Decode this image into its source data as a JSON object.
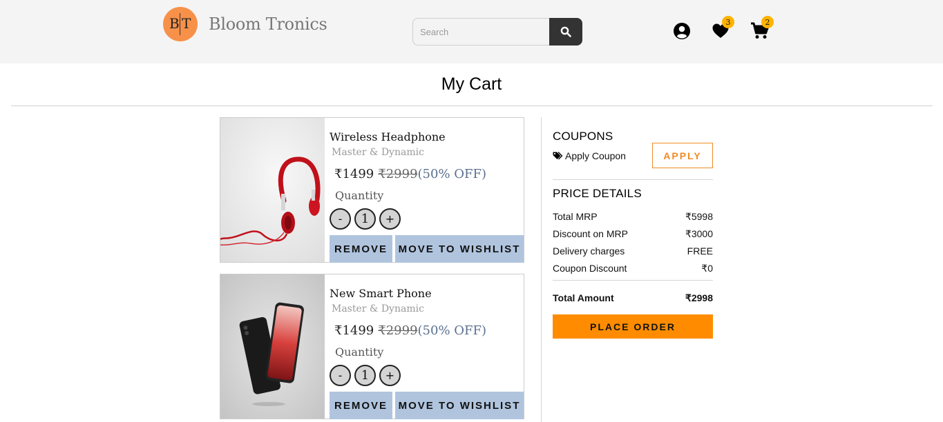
{
  "brand": {
    "letter1": "B",
    "letter2": "T",
    "name": "Bloom Tronics",
    "logo_color": "#f7914a"
  },
  "search": {
    "placeholder": "Search",
    "value": ""
  },
  "header_icons": {
    "wishlist_count": "3",
    "cart_count": "2"
  },
  "page": {
    "title": "My Cart"
  },
  "cart": {
    "items": [
      {
        "name": "Wireless Headphone",
        "brand": "Master & Dynamic",
        "price": "₹1499",
        "mrp": "₹2999",
        "discount": "(50% OFF)",
        "quantity_label": "Quantity",
        "quantity": "1",
        "minus": "-",
        "plus": "+",
        "remove_label": "REMOVE",
        "wishlist_label": "MOVE TO WISHLIST"
      },
      {
        "name": "New Smart Phone",
        "brand": "Master & Dynamic",
        "price": "₹1499",
        "mrp": "₹2999",
        "discount": "(50% OFF)",
        "quantity_label": "Quantity",
        "quantity": "1",
        "minus": "-",
        "plus": "+",
        "remove_label": "REMOVE",
        "wishlist_label": "MOVE TO WISHLIST"
      }
    ]
  },
  "coupons": {
    "title": "COUPONS",
    "apply_text": "Apply Coupon",
    "apply_button": "APPLY"
  },
  "price_details": {
    "title": "PRICE DETAILS",
    "rows": [
      {
        "label": "Total MRP",
        "value": "₹5998"
      },
      {
        "label": "Discount on MRP",
        "value": "₹3000"
      },
      {
        "label": "Delivery charges",
        "value": "FREE"
      },
      {
        "label": "Coupon Discount",
        "value": "₹0"
      }
    ],
    "total_label": "Total Amount",
    "total_value": "₹2998",
    "place_order": "PLACE ORDER"
  },
  "colors": {
    "accent": "#ff8c00",
    "button_blue": "#b0c4de",
    "badge": "#ffb300",
    "header_bg": "#f4f4f4"
  }
}
